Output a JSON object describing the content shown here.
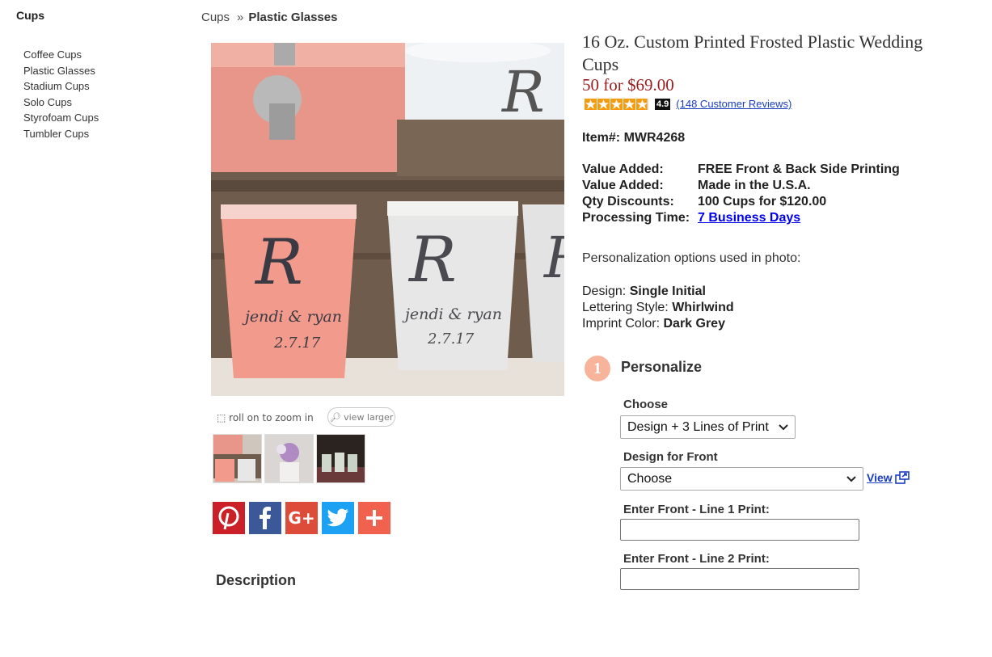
{
  "sidebar": {
    "title": "Cups",
    "items": [
      "Coffee Cups",
      "Plastic Glasses",
      "Stadium Cups",
      "Solo Cups",
      "Styrofoam Cups",
      "Tumbler Cups"
    ]
  },
  "breadcrumb": {
    "parent": "Cups",
    "separator": "»",
    "current": "Plastic Glasses"
  },
  "image": {
    "zoom_note": "roll on to zoom in",
    "view_larger": "view larger",
    "cup_text": {
      "initial": "R",
      "names": "jendi & ryan",
      "date": "2.7.17"
    }
  },
  "product": {
    "title": "16 Oz. Custom Printed Frosted Plastic Wedding Cups",
    "price": "50 for $69.00",
    "rating_score": "4.9",
    "rating_stars": 4.9,
    "reviews_link": "(148 Customer Reviews)",
    "item_number": "Item#: MWR4268",
    "specs": [
      {
        "label": "Value Added:",
        "value": "FREE Front & Back Side Printing"
      },
      {
        "label": "Value Added:",
        "value": "Made in the U.S.A."
      },
      {
        "label": "Qty Discounts:",
        "value": "100 Cups for $120.00"
      },
      {
        "label": "Processing Time:",
        "value": "7 Business Days"
      }
    ],
    "options_intro": "Personalization options used in photo:",
    "options": [
      {
        "label": "Design:",
        "value": "Single Initial"
      },
      {
        "label": "Lettering Style:",
        "value": "Whirlwind"
      },
      {
        "label": "Imprint Color:",
        "value": "Dark Grey"
      }
    ]
  },
  "personalize": {
    "step_number": "1",
    "title": "Personalize",
    "choose_label": "Choose",
    "choose_value": "Design + 3 Lines of Print",
    "design_front_label": "Design for Front",
    "design_front_value": "Choose",
    "view_link": "View",
    "line1_label": "Enter Front - Line 1 Print:",
    "line1_value": "",
    "line2_label": "Enter Front - Line 2 Print:",
    "line2_value": ""
  },
  "description_heading": "Description",
  "colors": {
    "price": "#9b1c1c",
    "link": "#1a3ec2",
    "step_circle": "#f7b49a",
    "pinterest": "#cb2027",
    "facebook": "#3b5998",
    "google_plus": "#dd4b39",
    "twitter": "#1da1f2",
    "share_more": "#f0624d"
  }
}
